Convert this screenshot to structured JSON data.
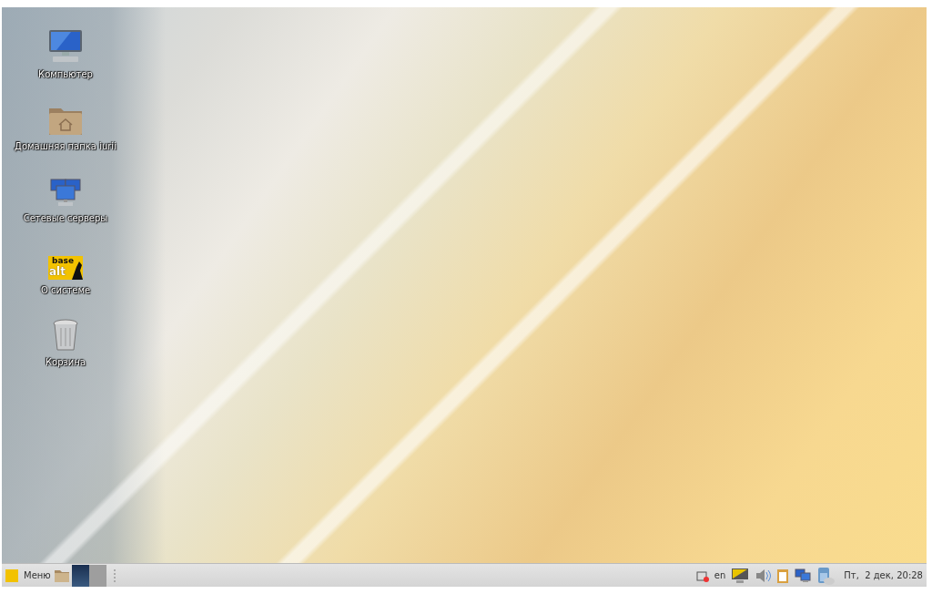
{
  "desktop_icons": [
    {
      "kind": "computer",
      "label": "Компьютер"
    },
    {
      "kind": "home-folder",
      "label": "Домашняя папка iurii"
    },
    {
      "kind": "network",
      "label": "Сетевые серверы"
    },
    {
      "kind": "logo",
      "label": "О системе",
      "logo_text": [
        "base",
        "alt"
      ]
    },
    {
      "kind": "trash",
      "label": "Корзина"
    }
  ],
  "taskbar": {
    "menu_label": "Меню",
    "pager": [
      {
        "selected": true
      },
      {
        "selected": false
      }
    ],
    "keyboard_layout": "en",
    "clock": "Пт,  2 дек, 20:28"
  }
}
